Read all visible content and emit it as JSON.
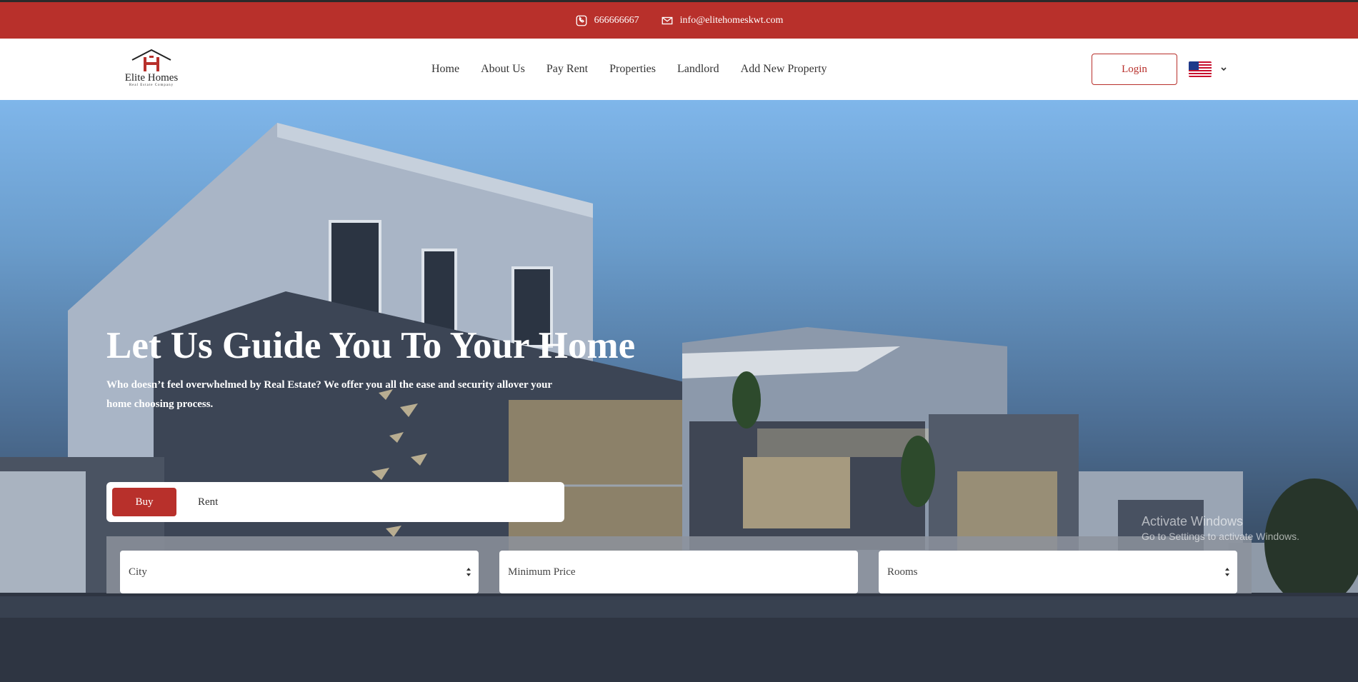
{
  "topbar": {
    "phone": "666666667",
    "email": "info@elitehomeskwt.com",
    "phone_icon": "phone-icon",
    "email_icon": "envelope-icon",
    "background": "#b8302b"
  },
  "logo": {
    "name": "Elite Homes",
    "tagline": "Real Estate Company"
  },
  "nav": {
    "items": [
      "Home",
      "About Us",
      "Pay Rent",
      "Properties",
      "Landlord",
      "Add New Property"
    ]
  },
  "header": {
    "login_label": "Login",
    "language_icon": "us-flag-icon"
  },
  "hero": {
    "title": "Let Us Guide You To Your Home",
    "subtitle": "Who doesn’t feel overwhelmed by Real Estate? We offer you all the ease and security allover your home choosing process."
  },
  "search": {
    "tabs": [
      "Buy",
      "Rent"
    ],
    "active_tab": "Buy",
    "city_placeholder": "City",
    "min_price_placeholder": "Minimum Price",
    "rooms_placeholder": "Rooms"
  },
  "watermark": {
    "line1": "Activate Windows",
    "line2": "Go to Settings to activate Windows."
  },
  "colors": {
    "accent": "#b8302b",
    "text": "#333333"
  }
}
